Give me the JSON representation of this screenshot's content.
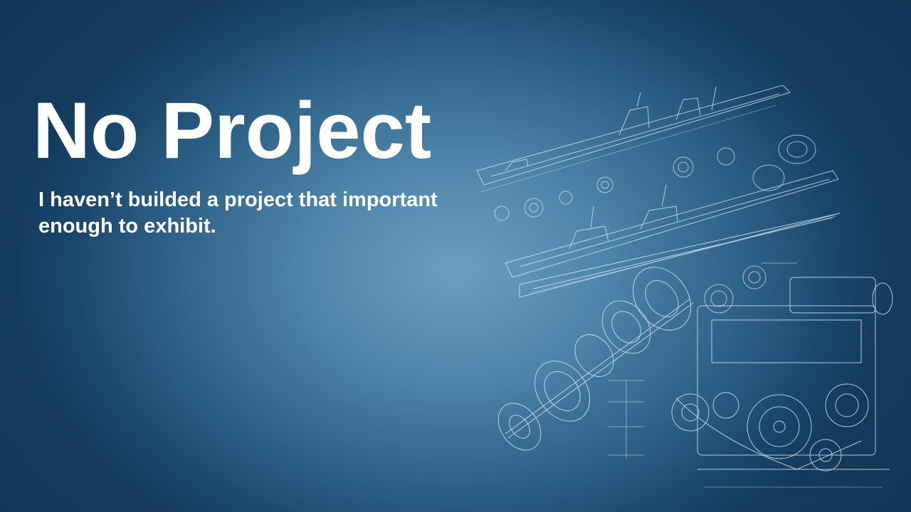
{
  "slide": {
    "title": "No Project",
    "subtitle": "I haven’t builded a project that important enough to exhibit.",
    "colors": {
      "background_center": "#6a9fc0",
      "background_edge": "#163f63",
      "text": "#ffffff",
      "line_art": "#dbe9f5"
    },
    "illustration": "engine-blueprint-illustration"
  }
}
